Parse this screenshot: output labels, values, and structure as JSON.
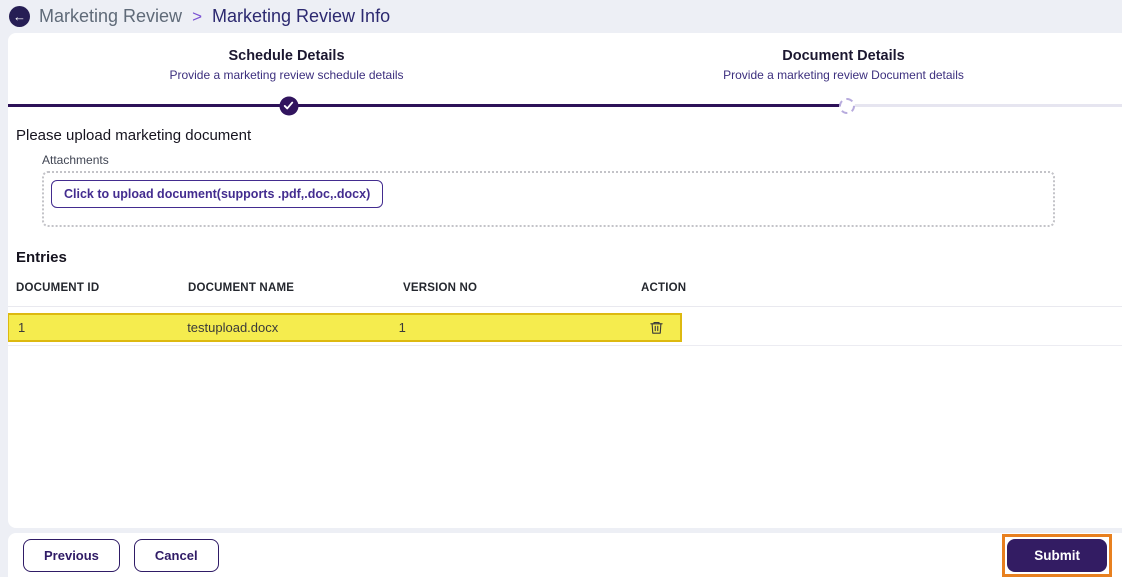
{
  "header": {
    "breadcrumb_parent": "Marketing Review",
    "breadcrumb_separator": ">",
    "breadcrumb_current": "Marketing Review Info"
  },
  "stepper": {
    "steps": [
      {
        "title": "Schedule Details",
        "subtitle": "Provide a marketing review schedule details",
        "state": "completed"
      },
      {
        "title": "Document Details",
        "subtitle": "Provide a marketing review Document details",
        "state": "pending"
      }
    ]
  },
  "upload_section": {
    "prompt": "Please upload marketing document",
    "attachments_label": "Attachments",
    "upload_button_label": "Click to upload document(supports .pdf,.doc,.docx)"
  },
  "entries": {
    "heading": "Entries",
    "columns": [
      "DOCUMENT ID",
      "DOCUMENT NAME",
      "VERSION NO",
      "ACTION"
    ],
    "rows": [
      {
        "document_id": "1",
        "document_name": "testupload.docx",
        "version_no": "1",
        "action_icon": "trash-icon",
        "highlighted": true
      }
    ]
  },
  "footer": {
    "previous_label": "Previous",
    "cancel_label": "Cancel",
    "submit_label": "Submit"
  },
  "colors": {
    "primary_purple": "#331c63",
    "stepper_line": "#2d1158",
    "highlight_yellow": "#f5ec4e",
    "highlight_border": "#ddb910",
    "submit_outline_orange": "#e8801f",
    "page_background": "#edeff5"
  }
}
